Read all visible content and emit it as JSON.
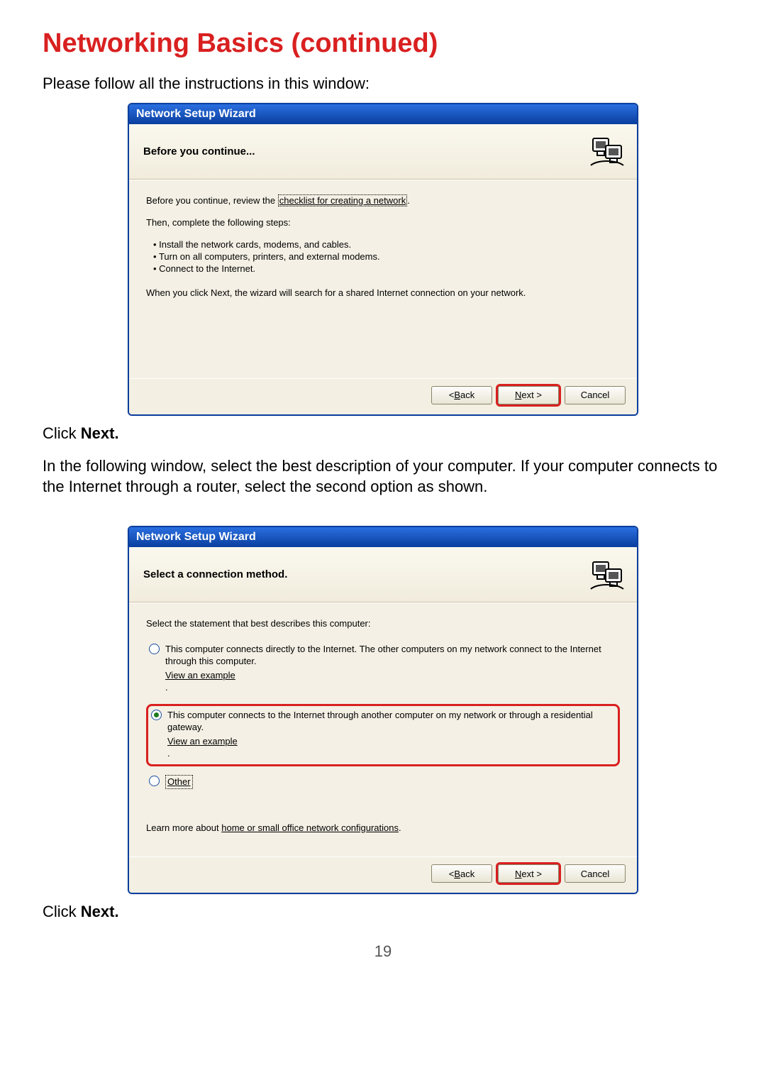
{
  "doc": {
    "title": "Networking Basics (continued)",
    "intro": "Please follow all the instructions in this window:",
    "click_next_prefix": "Click ",
    "click_next_bold": "Next.",
    "para2": "In the following window, select the best description of your computer. If your computer connects to the Internet through a router, select the second option as shown.",
    "page_number": "19"
  },
  "wizard1": {
    "title": "Network Setup Wizard",
    "header": "Before you continue...",
    "body": {
      "line1_prefix": "Before you continue, review the ",
      "line1_link": "checklist for creating a network",
      "line1_suffix": ".",
      "line2": "Then, complete the following steps:",
      "bullets": [
        "Install the network cards, modems, and cables.",
        "Turn on all computers, printers, and external modems.",
        "Connect to the Internet."
      ],
      "line3": "When you click Next, the wizard will search for a shared Internet connection on your network."
    },
    "buttons": {
      "back": "< Back",
      "next": "Next >",
      "cancel": "Cancel"
    }
  },
  "wizard2": {
    "title": "Network Setup Wizard",
    "header": "Select a connection method.",
    "body": {
      "intro": "Select the statement that best describes this computer:",
      "opt1": "This computer connects directly to the Internet. The other computers on my network connect to the Internet through this computer.",
      "opt2": "This computer connects to the Internet through another computer on my network or through a residential gateway.",
      "view_example": "View an example",
      "opt3": "Other",
      "learn_prefix": "Learn more about ",
      "learn_link": "home or small office network configurations",
      "learn_suffix": "."
    },
    "buttons": {
      "back": "< Back",
      "next": "Next >",
      "cancel": "Cancel"
    }
  }
}
